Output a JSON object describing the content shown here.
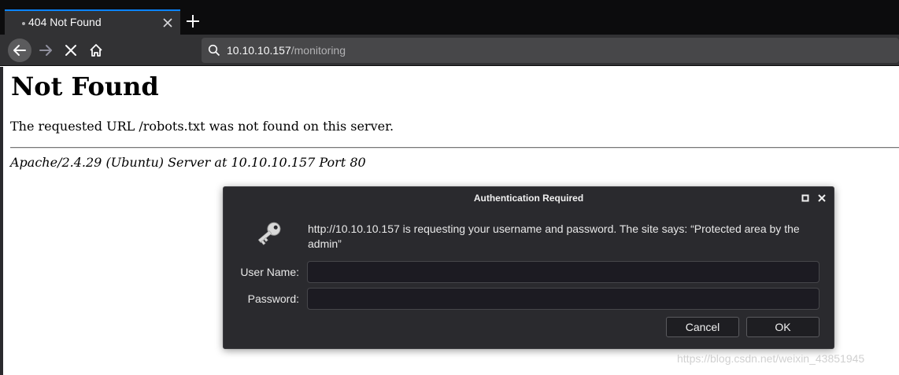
{
  "browser": {
    "tab": {
      "title": "404 Not Found"
    },
    "address": {
      "host": "10.10.10.157",
      "path": "/monitoring"
    },
    "icons": [
      "back-icon",
      "forward-icon",
      "stop-icon",
      "home-icon",
      "search-icon",
      "close-icon",
      "plus-icon"
    ]
  },
  "page": {
    "heading": "Not Found",
    "message": "The requested URL /robots.txt was not found on this server.",
    "signature": "Apache/2.4.29 (Ubuntu) Server at 10.10.10.157 Port 80"
  },
  "dialog": {
    "title": "Authentication Required",
    "prompt": "http://10.10.10.157 is requesting your username and password. The site says: “Protected area by the admin”",
    "username_label": "User Name:",
    "username_value": "",
    "password_label": "Password:",
    "password_value": "",
    "cancel_label": "Cancel",
    "ok_label": "OK",
    "icon": "key-icon"
  },
  "watermark": "https://blog.csdn.net/weixin_43851945",
  "colors": {
    "accent": "#0a84ff",
    "chrome_dark": "#0c0c0d",
    "toolbar": "#323234",
    "dialog_bg": "#2a2a2e"
  }
}
